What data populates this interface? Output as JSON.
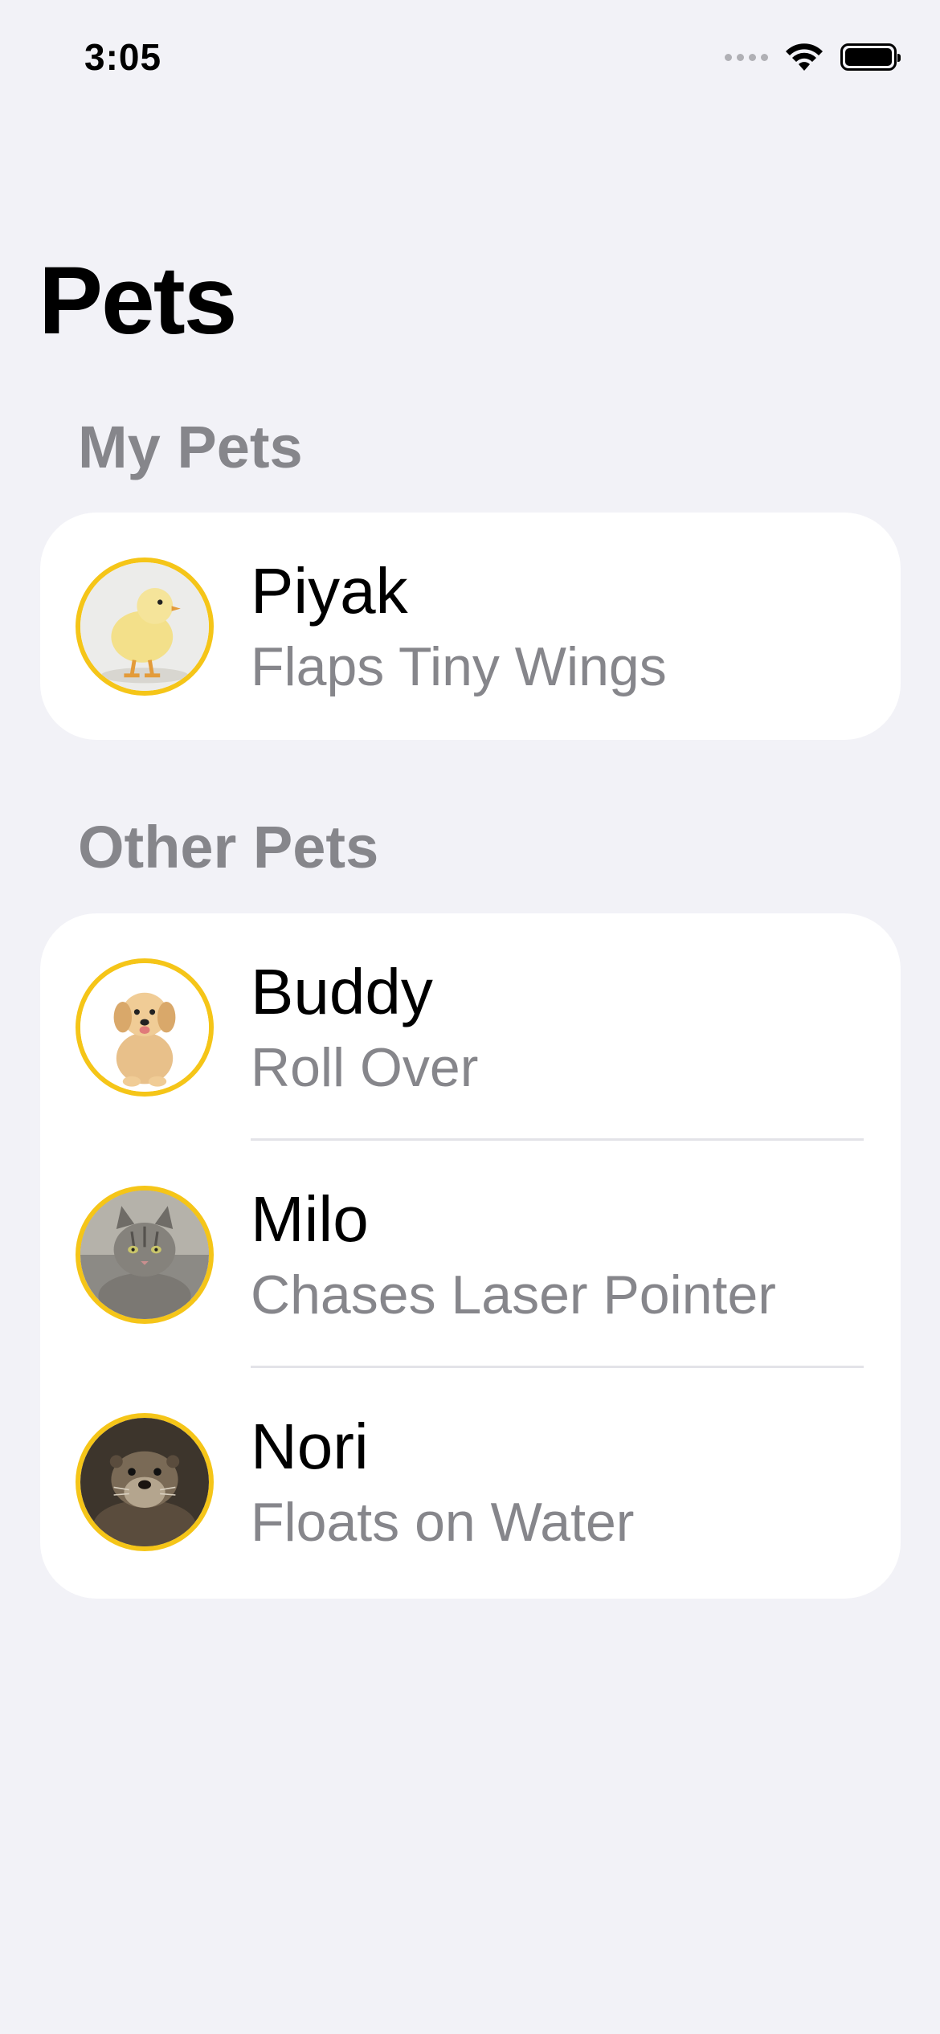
{
  "status_bar": {
    "time": "3:05"
  },
  "page_title": "Pets",
  "sections": {
    "my_pets": {
      "header": "My Pets",
      "pets": [
        {
          "name": "Piyak",
          "trick": "Flaps Tiny Wings",
          "avatar_icon": "chick-photo"
        }
      ]
    },
    "other_pets": {
      "header": "Other Pets",
      "pets": [
        {
          "name": "Buddy",
          "trick": "Roll Over",
          "avatar_icon": "puppy-photo"
        },
        {
          "name": "Milo",
          "trick": "Chases Laser Pointer",
          "avatar_icon": "cat-photo"
        },
        {
          "name": "Nori",
          "trick": "Floats on Water",
          "avatar_icon": "otter-photo"
        }
      ]
    }
  },
  "colors": {
    "background": "#f2f2f7",
    "card": "#ffffff",
    "avatar_ring": "#f5c518",
    "secondary_text": "#86868b"
  }
}
